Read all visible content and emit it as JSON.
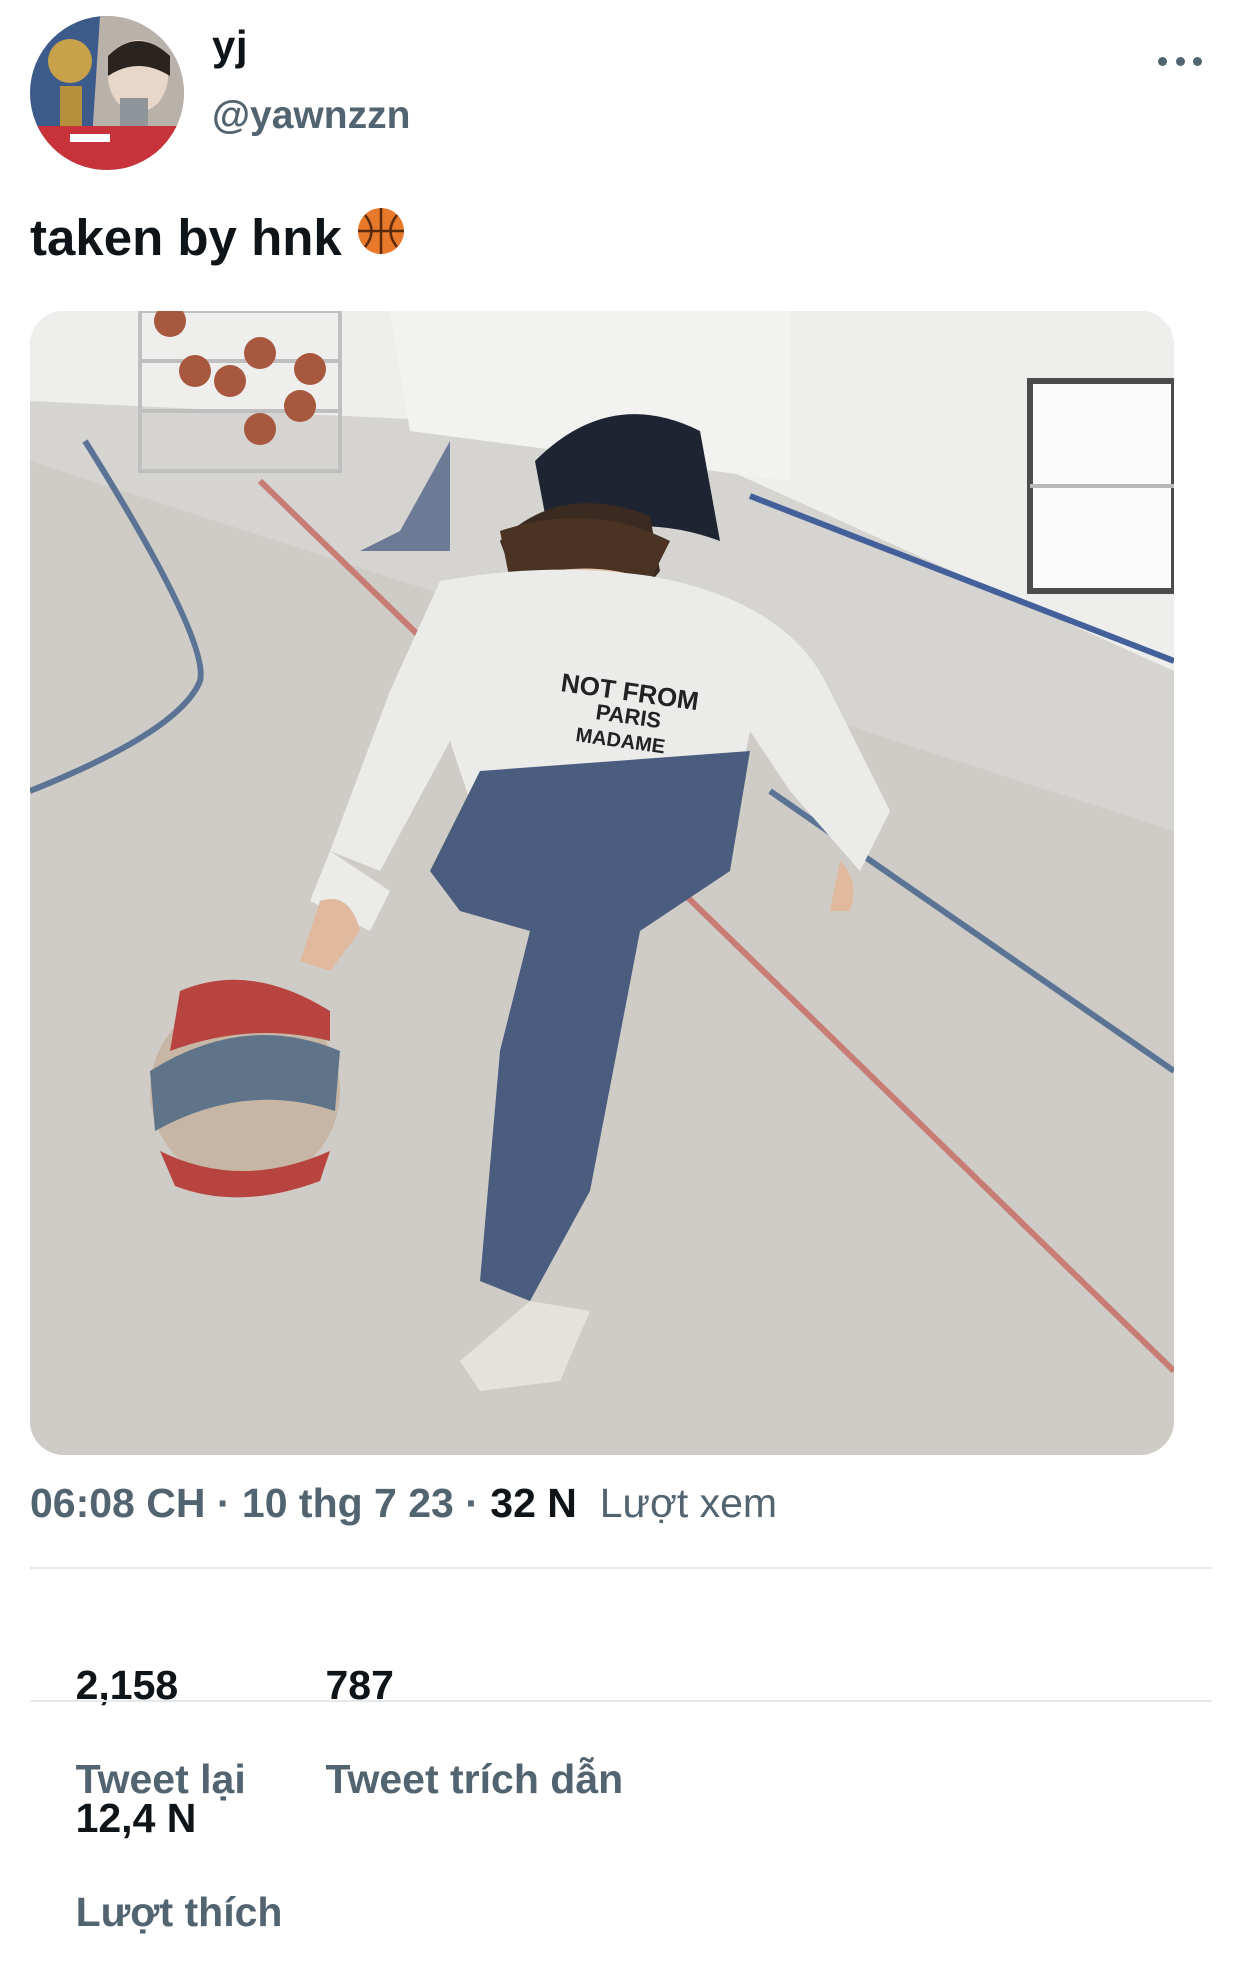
{
  "user": {
    "display_name": "yj",
    "handle": "@yawnzzn",
    "avatar_icon": "profile-photo"
  },
  "tweet": {
    "text": "taken by hnk",
    "emoji": "basketball-emoji",
    "image_shirt_text": [
      "NOT FROM",
      "PARIS",
      "MADAME"
    ]
  },
  "meta": {
    "time": "06:08 CH",
    "date": "10 thg 7 23",
    "separator": " · ",
    "views_count": "32 N",
    "views_label": "Lượt xem"
  },
  "stats": {
    "retweets_count": "2,158",
    "retweets_label": "Tweet lại",
    "quotes_count": "787",
    "quotes_label": "Tweet trích dẫn",
    "likes_count": "12,4 N",
    "likes_label": "Lượt thích"
  },
  "colors": {
    "text_primary": "#0f1419",
    "text_secondary": "#536471",
    "divider": "#e6e8ea",
    "basketball": "#e8782a"
  }
}
